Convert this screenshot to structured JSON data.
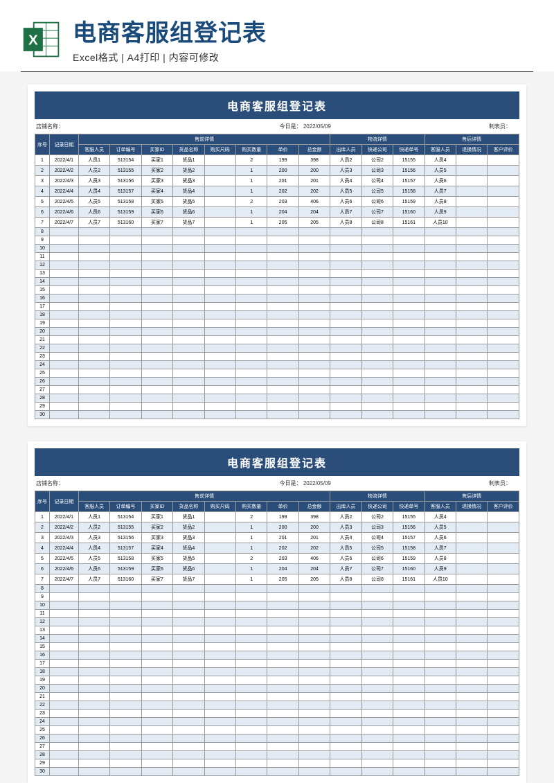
{
  "header": {
    "main_title": "电商客服组登记表",
    "sub_title": "Excel格式 | A4打印 | 内容可修改"
  },
  "sheet": {
    "title": "电商客服组登记表",
    "meta": {
      "shop_label": "店铺名称：",
      "date_label": "今日是：",
      "date_value": "2022/05/09",
      "preparer_label": "制表员："
    },
    "group_headers": {
      "seq": "序号",
      "date": "记录日期",
      "presale": "售前详情",
      "logistics": "物流详情",
      "aftersale": "售后详情"
    },
    "columns": [
      "客服人员",
      "订单编号",
      "买家ID",
      "货品名称",
      "购买尺码",
      "购买数量",
      "单价",
      "总金额",
      "出库人员",
      "快递公司",
      "快递单号",
      "客服人员",
      "退换情况",
      "客户评价"
    ],
    "rows": [
      {
        "seq": "1",
        "date": "2022/4/1",
        "c": [
          "人员1",
          "513154",
          "买家1",
          "货品1",
          "",
          "2",
          "199",
          "398",
          "人员2",
          "公司2",
          "15155",
          "人员4",
          "",
          ""
        ]
      },
      {
        "seq": "2",
        "date": "2022/4/2",
        "c": [
          "人员2",
          "513155",
          "买家2",
          "货品2",
          "",
          "1",
          "200",
          "200",
          "人员3",
          "公司3",
          "15156",
          "人员5",
          "",
          ""
        ]
      },
      {
        "seq": "3",
        "date": "2022/4/3",
        "c": [
          "人员3",
          "513156",
          "买家3",
          "货品3",
          "",
          "1",
          "201",
          "201",
          "人员4",
          "公司4",
          "15157",
          "人员6",
          "",
          ""
        ]
      },
      {
        "seq": "4",
        "date": "2022/4/4",
        "c": [
          "人员4",
          "513157",
          "买家4",
          "货品4",
          "",
          "1",
          "202",
          "202",
          "人员5",
          "公司5",
          "15158",
          "人员7",
          "",
          ""
        ]
      },
      {
        "seq": "5",
        "date": "2022/4/5",
        "c": [
          "人员5",
          "513158",
          "买家5",
          "货品5",
          "",
          "2",
          "203",
          "406",
          "人员6",
          "公司6",
          "15159",
          "人员8",
          "",
          ""
        ]
      },
      {
        "seq": "6",
        "date": "2022/4/6",
        "c": [
          "人员6",
          "513159",
          "买家6",
          "货品6",
          "",
          "1",
          "204",
          "204",
          "人员7",
          "公司7",
          "15160",
          "人员9",
          "",
          ""
        ]
      },
      {
        "seq": "7",
        "date": "2022/4/7",
        "c": [
          "人员7",
          "513160",
          "买家7",
          "货品7",
          "",
          "1",
          "205",
          "205",
          "人员8",
          "公司8",
          "15161",
          "人员10",
          "",
          ""
        ]
      }
    ],
    "empty_rows": [
      "8",
      "9",
      "10",
      "11",
      "12",
      "13",
      "14",
      "15",
      "16",
      "17",
      "18",
      "19",
      "20",
      "21",
      "22",
      "23",
      "24",
      "25",
      "26",
      "27",
      "28",
      "29",
      "30"
    ]
  },
  "chart_data": {
    "type": "table",
    "title": "电商客服组登记表",
    "columns": [
      "序号",
      "记录日期",
      "客服人员",
      "订单编号",
      "买家ID",
      "货品名称",
      "购买尺码",
      "购买数量",
      "单价",
      "总金额",
      "出库人员",
      "快递公司",
      "快递单号",
      "客服人员",
      "退换情况",
      "客户评价"
    ],
    "rows": [
      [
        1,
        "2022/4/1",
        "人员1",
        "513154",
        "买家1",
        "货品1",
        "",
        2,
        199,
        398,
        "人员2",
        "公司2",
        "15155",
        "人员4",
        "",
        ""
      ],
      [
        2,
        "2022/4/2",
        "人员2",
        "513155",
        "买家2",
        "货品2",
        "",
        1,
        200,
        200,
        "人员3",
        "公司3",
        "15156",
        "人员5",
        "",
        ""
      ],
      [
        3,
        "2022/4/3",
        "人员3",
        "513156",
        "买家3",
        "货品3",
        "",
        1,
        201,
        201,
        "人员4",
        "公司4",
        "15157",
        "人员6",
        "",
        ""
      ],
      [
        4,
        "2022/4/4",
        "人员4",
        "513157",
        "买家4",
        "货品4",
        "",
        1,
        202,
        202,
        "人员5",
        "公司5",
        "15158",
        "人员7",
        "",
        ""
      ],
      [
        5,
        "2022/4/5",
        "人员5",
        "513158",
        "买家5",
        "货品5",
        "",
        2,
        203,
        406,
        "人员6",
        "公司6",
        "15159",
        "人员8",
        "",
        ""
      ],
      [
        6,
        "2022/4/6",
        "人员6",
        "513159",
        "买家6",
        "货品6",
        "",
        1,
        204,
        204,
        "人员7",
        "公司7",
        "15160",
        "人员9",
        "",
        ""
      ],
      [
        7,
        "2022/4/7",
        "人员7",
        "513160",
        "买家7",
        "货品7",
        "",
        1,
        205,
        205,
        "人员8",
        "公司8",
        "15161",
        "人员10",
        "",
        ""
      ]
    ]
  }
}
